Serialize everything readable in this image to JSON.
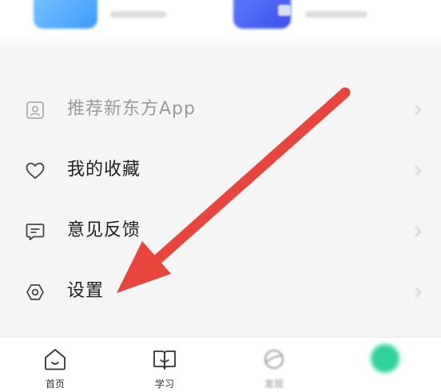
{
  "menu": {
    "items": [
      {
        "label": "推荐新东方App",
        "icon": "app-recommend-icon"
      },
      {
        "label": "我的收藏",
        "icon": "heart-icon"
      },
      {
        "label": "意见反馈",
        "icon": "feedback-icon"
      },
      {
        "label": "设置",
        "icon": "settings-hexagon-icon"
      }
    ]
  },
  "tabbar": {
    "tabs": [
      {
        "label": "首页",
        "icon": "home-icon"
      },
      {
        "label": "学习",
        "icon": "book-icon"
      },
      {
        "label": "发现",
        "icon": "planet-icon"
      },
      {
        "label": "",
        "icon": "profile-icon"
      }
    ]
  },
  "colors": {
    "annotation_arrow": "#e8453c",
    "profile_tab_accent": "#2ed39a",
    "shortcut_blue": "#3b9bff",
    "shortcut_indigo": "#3a52e8"
  }
}
